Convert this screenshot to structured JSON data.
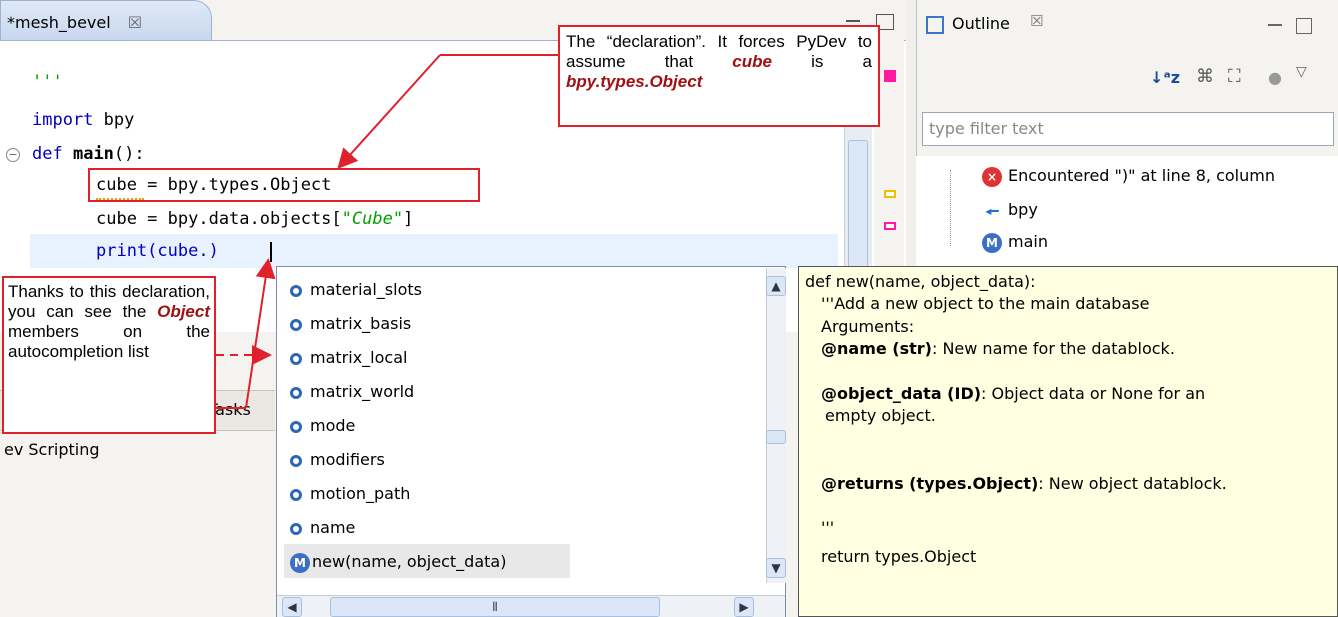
{
  "editor": {
    "tab_label": "*mesh_bevel",
    "tab_close": "☒",
    "code_lines": {
      "l1": "'''",
      "l2_kw": "import",
      "l2_rest": " bpy",
      "l3_kw": "def",
      "l3_name": "main",
      "l3_rest": "():",
      "l4": "cube = bpy.types.Object",
      "l5_a": "cube = bpy.data.objects[",
      "l5_str": "\"Cube\"",
      "l5_b": "]",
      "l6": "print(cube.)"
    }
  },
  "lower_view": {
    "tasks_label": "Tasks",
    "title": "ev Scripting"
  },
  "outline": {
    "title": "Outline",
    "close": "☒",
    "filter_placeholder": "type filter text",
    "items": [
      {
        "label": "Encountered \")\" at line 8, column",
        "icon": "error-icon"
      },
      {
        "label": "bpy",
        "icon": "import-icon"
      },
      {
        "label": "main",
        "icon": "method-icon"
      }
    ]
  },
  "completion": {
    "items": [
      "material_slots",
      "matrix_basis",
      "matrix_local",
      "matrix_world",
      "mode",
      "modifiers",
      "motion_path",
      "name",
      "new(name, object_data)"
    ],
    "selected_index": 8
  },
  "doc": {
    "signature": "def new(name, object_data):",
    "line1": "'''Add a new object to the main database",
    "line2": "Arguments:",
    "name_param": "@name (str)",
    "name_desc": ": New name for the datablock.",
    "obj_param": "@object_data (ID)",
    "obj_desc": ": Object data or None for an",
    "obj_desc2": "empty object.",
    "ret_param": "@returns (types.Object)",
    "ret_desc": ": New object datablock.",
    "end_quote": "'''",
    "return_line": "return types.Object"
  },
  "callouts": {
    "top_a": "The “declaration”. It forces PyDev to assume that ",
    "top_cube": "cube",
    "top_b": " is a ",
    "top_type": "bpy.types.Object",
    "left_a": "Thanks to this declaration, you can see the ",
    "left_obj": "Object",
    "left_b": " members on the autocompletion list"
  },
  "colors": {
    "callout_border": "#e0202a",
    "emphasis": "#a01010",
    "keyword": "#0000c0",
    "string": "#00a000",
    "doc_bg": "#ffffe1"
  }
}
